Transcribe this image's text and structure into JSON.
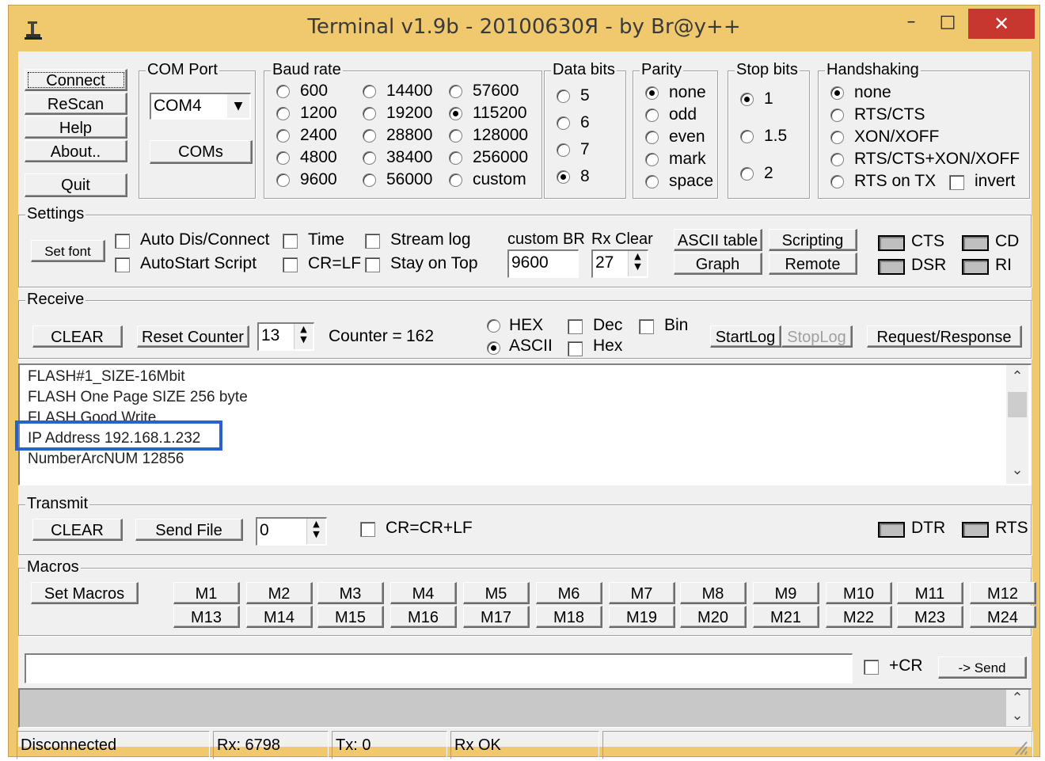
{
  "window": {
    "title": "Terminal v1.9b - 20100630Я - by Br@y++",
    "minimize_glyph": "–",
    "maximize_glyph": "□",
    "close_glyph": "✕",
    "frame_color": "#f0c96e",
    "close_color": "#c7372f"
  },
  "left_buttons": {
    "connect": "Connect",
    "rescan": "ReScan",
    "help": "Help",
    "about": "About..",
    "quit": "Quit"
  },
  "com_port": {
    "title": "COM Port",
    "selected": "COM4",
    "coms_button": "COMs"
  },
  "baud_rate": {
    "title": "Baud rate",
    "options": [
      "600",
      "1200",
      "2400",
      "4800",
      "9600",
      "14400",
      "19200",
      "28800",
      "38400",
      "56000",
      "57600",
      "115200",
      "128000",
      "256000",
      "custom"
    ],
    "selected": "115200"
  },
  "data_bits": {
    "title": "Data bits",
    "options": [
      "5",
      "6",
      "7",
      "8"
    ],
    "selected": "8"
  },
  "parity": {
    "title": "Parity",
    "options": [
      "none",
      "odd",
      "even",
      "mark",
      "space"
    ],
    "selected": "none"
  },
  "stop_bits": {
    "title": "Stop bits",
    "options": [
      "1",
      "1.5",
      "2"
    ],
    "selected": "1"
  },
  "handshaking": {
    "title": "Handshaking",
    "options": [
      "none",
      "RTS/CTS",
      "XON/XOFF",
      "RTS/CTS+XON/XOFF",
      "RTS on TX"
    ],
    "selected": "none",
    "invert_label": "invert"
  },
  "settings": {
    "title": "Settings",
    "set_font": "Set font",
    "auto_dis_connect": "Auto Dis/Connect",
    "autostart_script": "AutoStart Script",
    "time": "Time",
    "cr_lf": "CR=LF",
    "stream_log": "Stream log",
    "stay_on_top": "Stay on Top",
    "custom_br_label": "custom BR",
    "custom_br_value": "9600",
    "rx_clear_label": "Rx Clear",
    "rx_clear_value": "27",
    "ascii_table": "ASCII table",
    "graph": "Graph",
    "scripting": "Scripting",
    "remote": "Remote",
    "cts": "CTS",
    "cd": "CD",
    "dsr": "DSR",
    "ri": "RI"
  },
  "receive": {
    "title": "Receive",
    "clear": "CLEAR",
    "reset_counter": "Reset Counter",
    "counter_spin": "13",
    "counter_label": "Counter =",
    "counter_value": "162",
    "hex": "HEX",
    "ascii": "ASCII",
    "mode_selected": "ASCII",
    "dec": "Dec",
    "hex_chk": "Hex",
    "bin": "Bin",
    "startlog": "StartLog",
    "stoplog": "StopLog",
    "request_response": "Request/Response"
  },
  "receive_log": {
    "lines": [
      "FLASH#1_SIZE-16Mbit",
      "FLASH One Page SIZE 256 byte",
      "FLASH Good Write",
      "IP Address 192.168.1.232",
      "NumberArcNUM 12856"
    ],
    "highlight_color": "#2a62c9"
  },
  "transmit": {
    "title": "Transmit",
    "clear": "CLEAR",
    "send_file": "Send File",
    "spin_value": "0",
    "cr_crlf": "CR=CR+LF",
    "dtr": "DTR",
    "rts": "RTS"
  },
  "macros": {
    "title": "Macros",
    "set_macros": "Set Macros",
    "row1": [
      "M1",
      "M2",
      "M3",
      "M4",
      "M5",
      "M6",
      "M7",
      "M8",
      "M9",
      "M10",
      "M11",
      "M12"
    ],
    "row2": [
      "M13",
      "M14",
      "M15",
      "M16",
      "M17",
      "M18",
      "M19",
      "M20",
      "M21",
      "M22",
      "M23",
      "M24"
    ]
  },
  "send_bar": {
    "input_value": "",
    "plus_cr": "+CR",
    "send": "-> Send"
  },
  "status": {
    "connection": "Disconnected",
    "rx": "Rx: 6798",
    "tx": "Tx: 0",
    "rx_state": "Rx OK"
  }
}
